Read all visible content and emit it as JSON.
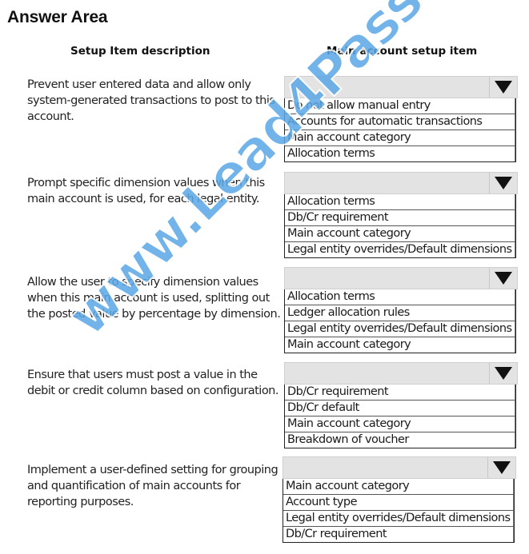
{
  "title": "Answer Area",
  "columns": {
    "left": "Setup Item description",
    "right": "Main account setup item"
  },
  "rows": [
    {
      "description": "Prevent user entered data and allow only system-generated transactions to post to this account.",
      "selected": "",
      "options": [
        "Do not allow manual entry",
        "Accounts for automatic transactions",
        "Main account category",
        "Allocation terms"
      ]
    },
    {
      "description": "Prompt specific dimension values when this main account is used, for each legal entity.",
      "selected": "",
      "options": [
        "Allocation terms",
        "Db/Cr requirement",
        "Main account category",
        "Legal entity overrides/Default dimensions"
      ]
    },
    {
      "description": "Allow the user to specify dimension values when this main account is used, splitting out the posted value by percentage by dimension.",
      "selected": "",
      "options": [
        "Allocation terms",
        "Ledger allocation rules",
        "Legal entity overrides/Default dimensions",
        "Main account category"
      ]
    },
    {
      "description": "Ensure that users must post a value in the debit or credit column based on configuration.",
      "selected": "",
      "options": [
        "Db/Cr requirement",
        "Db/Cr default",
        "Main account category",
        "Breakdown of voucher"
      ]
    },
    {
      "description": "Implement a user-defined setting for grouping and quantification of main accounts for reporting purposes.",
      "selected": "",
      "options": [
        "Main account category",
        "Account type",
        "Legal entity overrides/Default dimensions",
        "Db/Cr requirement"
      ]
    }
  ],
  "watermark": "www.Lead4Pass.com",
  "icons": {
    "dropdown": "triangle-down-icon"
  }
}
